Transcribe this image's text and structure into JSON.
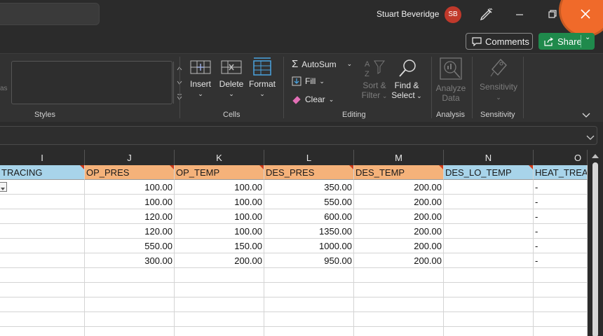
{
  "titlebar": {
    "user_name": "Stuart Beveridge",
    "avatar_initials": "SB",
    "avatar_color": "#c0392b",
    "close_highlight_color": "#f06a2a"
  },
  "actions": {
    "comments_label": "Comments",
    "share_label": "Share",
    "share_color": "#1f8a4c"
  },
  "ribbon": {
    "styles_left_partial": "as",
    "styles_label": "Styles",
    "cells_label": "Cells",
    "insert_label": "Insert",
    "delete_label": "Delete",
    "format_label": "Format",
    "editing_label": "Editing",
    "autosum_label": "AutoSum",
    "fill_label": "Fill",
    "clear_label": "Clear",
    "sort_filter_label_1": "Sort &",
    "sort_filter_label_2": "Filter",
    "find_select_label_1": "Find &",
    "find_select_label_2": "Select",
    "analysis_label": "Analysis",
    "analyze_data_label_1": "Analyze",
    "analyze_data_label_2": "Data",
    "sensitivity_group_label": "Sensitivity",
    "sensitivity_button_label": "Sensitivity"
  },
  "sheet": {
    "columns": [
      {
        "letter": "I",
        "header": "TRACING",
        "header_color": "blue"
      },
      {
        "letter": "J",
        "header": "OP_PRES",
        "header_color": "orange"
      },
      {
        "letter": "K",
        "header": "OP_TEMP",
        "header_color": "orange"
      },
      {
        "letter": "L",
        "header": "DES_PRES",
        "header_color": "orange"
      },
      {
        "letter": "M",
        "header": "DES_TEMP",
        "header_color": "orange"
      },
      {
        "letter": "N",
        "header": "DES_LO_TEMP",
        "header_color": "blue"
      },
      {
        "letter": "O",
        "header": "HEAT_TREA",
        "header_color": "blue"
      }
    ],
    "rows": [
      [
        "",
        "100.00",
        "100.00",
        "350.00",
        "200.00",
        "",
        "-"
      ],
      [
        "",
        "100.00",
        "100.00",
        "550.00",
        "200.00",
        "",
        "-"
      ],
      [
        "",
        "120.00",
        "100.00",
        "600.00",
        "200.00",
        "",
        "-"
      ],
      [
        "",
        "120.00",
        "100.00",
        "1350.00",
        "200.00",
        "",
        "-"
      ],
      [
        "",
        "550.00",
        "150.00",
        "1000.00",
        "200.00",
        "",
        "-"
      ],
      [
        "",
        "300.00",
        "200.00",
        "950.00",
        "200.00",
        "",
        "-"
      ]
    ],
    "header_blue": "#a8d4ea",
    "header_orange": "#f5b27a"
  }
}
